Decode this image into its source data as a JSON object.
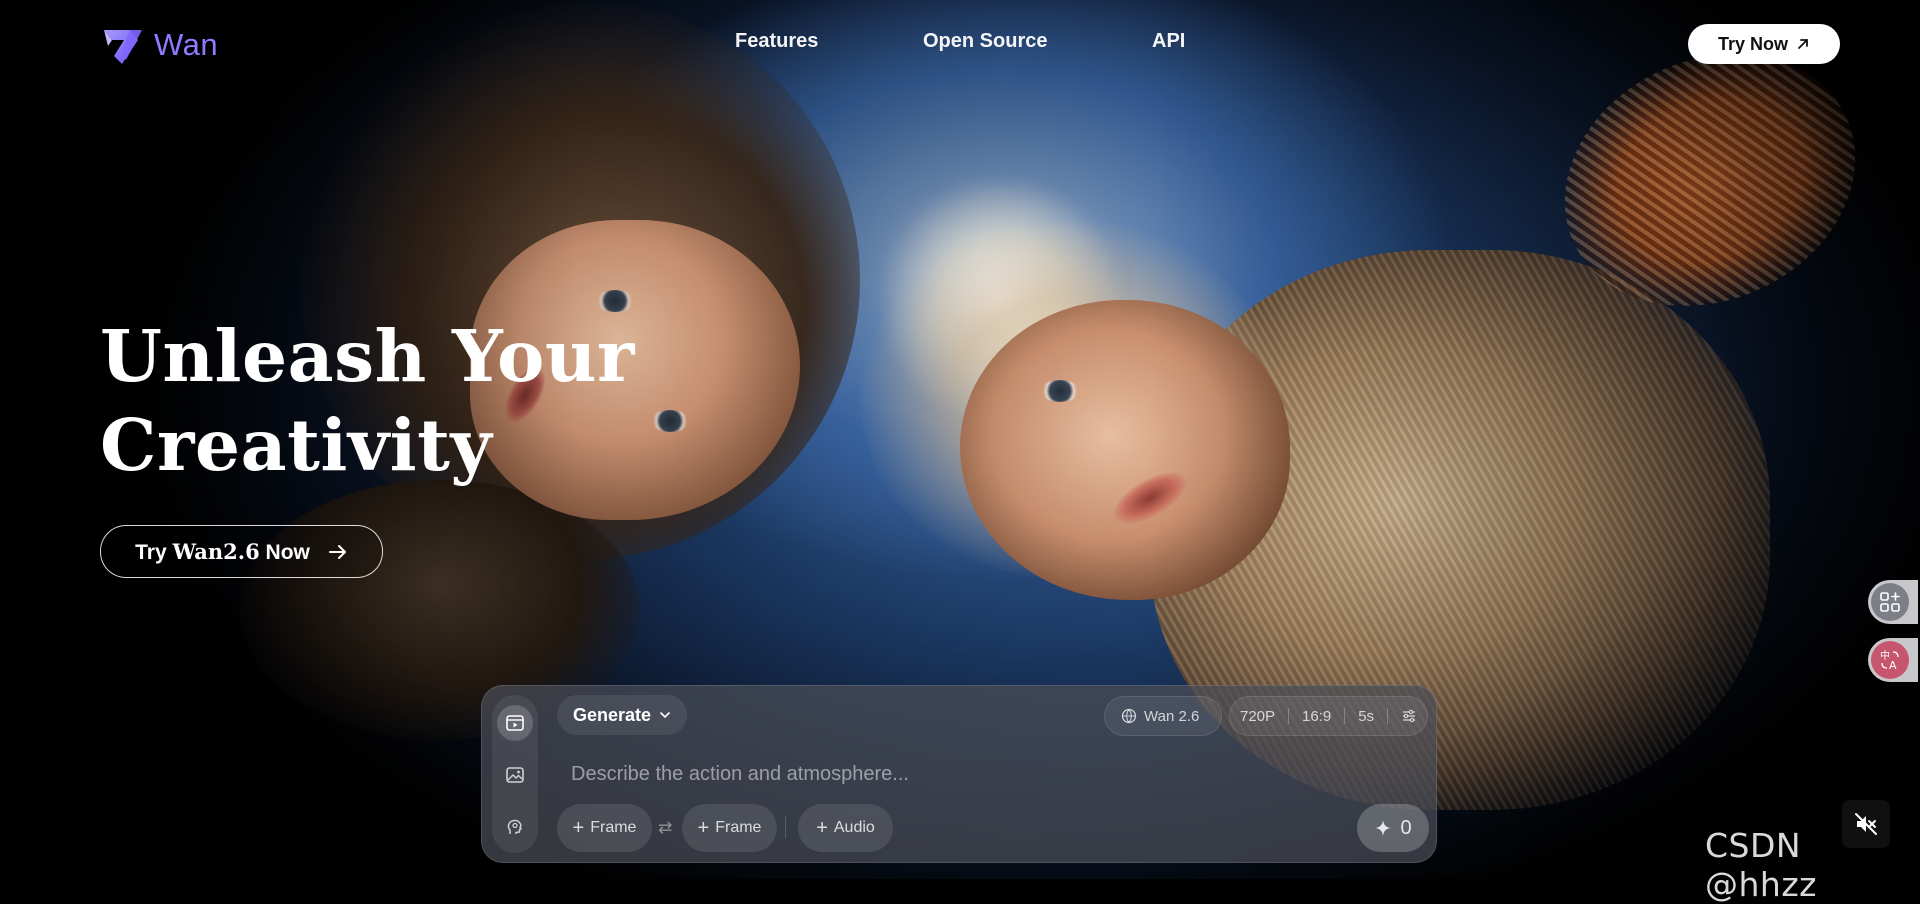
{
  "brand": {
    "name": "Wan",
    "accent": "#8d7cff",
    "logo_icon": "wan-logo-icon"
  },
  "nav": {
    "items": [
      "Features",
      "Open Source",
      "API"
    ]
  },
  "header": {
    "try_now_label": "Try Now",
    "try_now_icon": "arrow-up-right-icon"
  },
  "hero": {
    "title_line1": "Unleash Your",
    "title_line2": "Creativity",
    "cta_prefix": "Try",
    "cta_model": "Wan2.6",
    "cta_suffix": "Now",
    "cta_icon": "arrow-right-icon"
  },
  "floating_buttons": [
    {
      "icon": "apps-add-icon"
    },
    {
      "icon": "translate-icon"
    }
  ],
  "composer": {
    "mode_rail": [
      {
        "icon": "video-icon",
        "active": true
      },
      {
        "icon": "image-icon",
        "active": false
      },
      {
        "icon": "avatar-icon",
        "active": false
      }
    ],
    "generate_label": "Generate",
    "model_label": "Wan 2.6",
    "settings": {
      "resolution": "720P",
      "aspect": "16:9",
      "duration": "5s"
    },
    "prompt_placeholder": "Describe the action and atmosphere...",
    "chips": {
      "frame1": "Frame",
      "frame2": "Frame",
      "audio": "Audio"
    },
    "send_count": "0"
  },
  "mute_icon": "speaker-muted-icon",
  "watermark": "CSDN @hhzz"
}
